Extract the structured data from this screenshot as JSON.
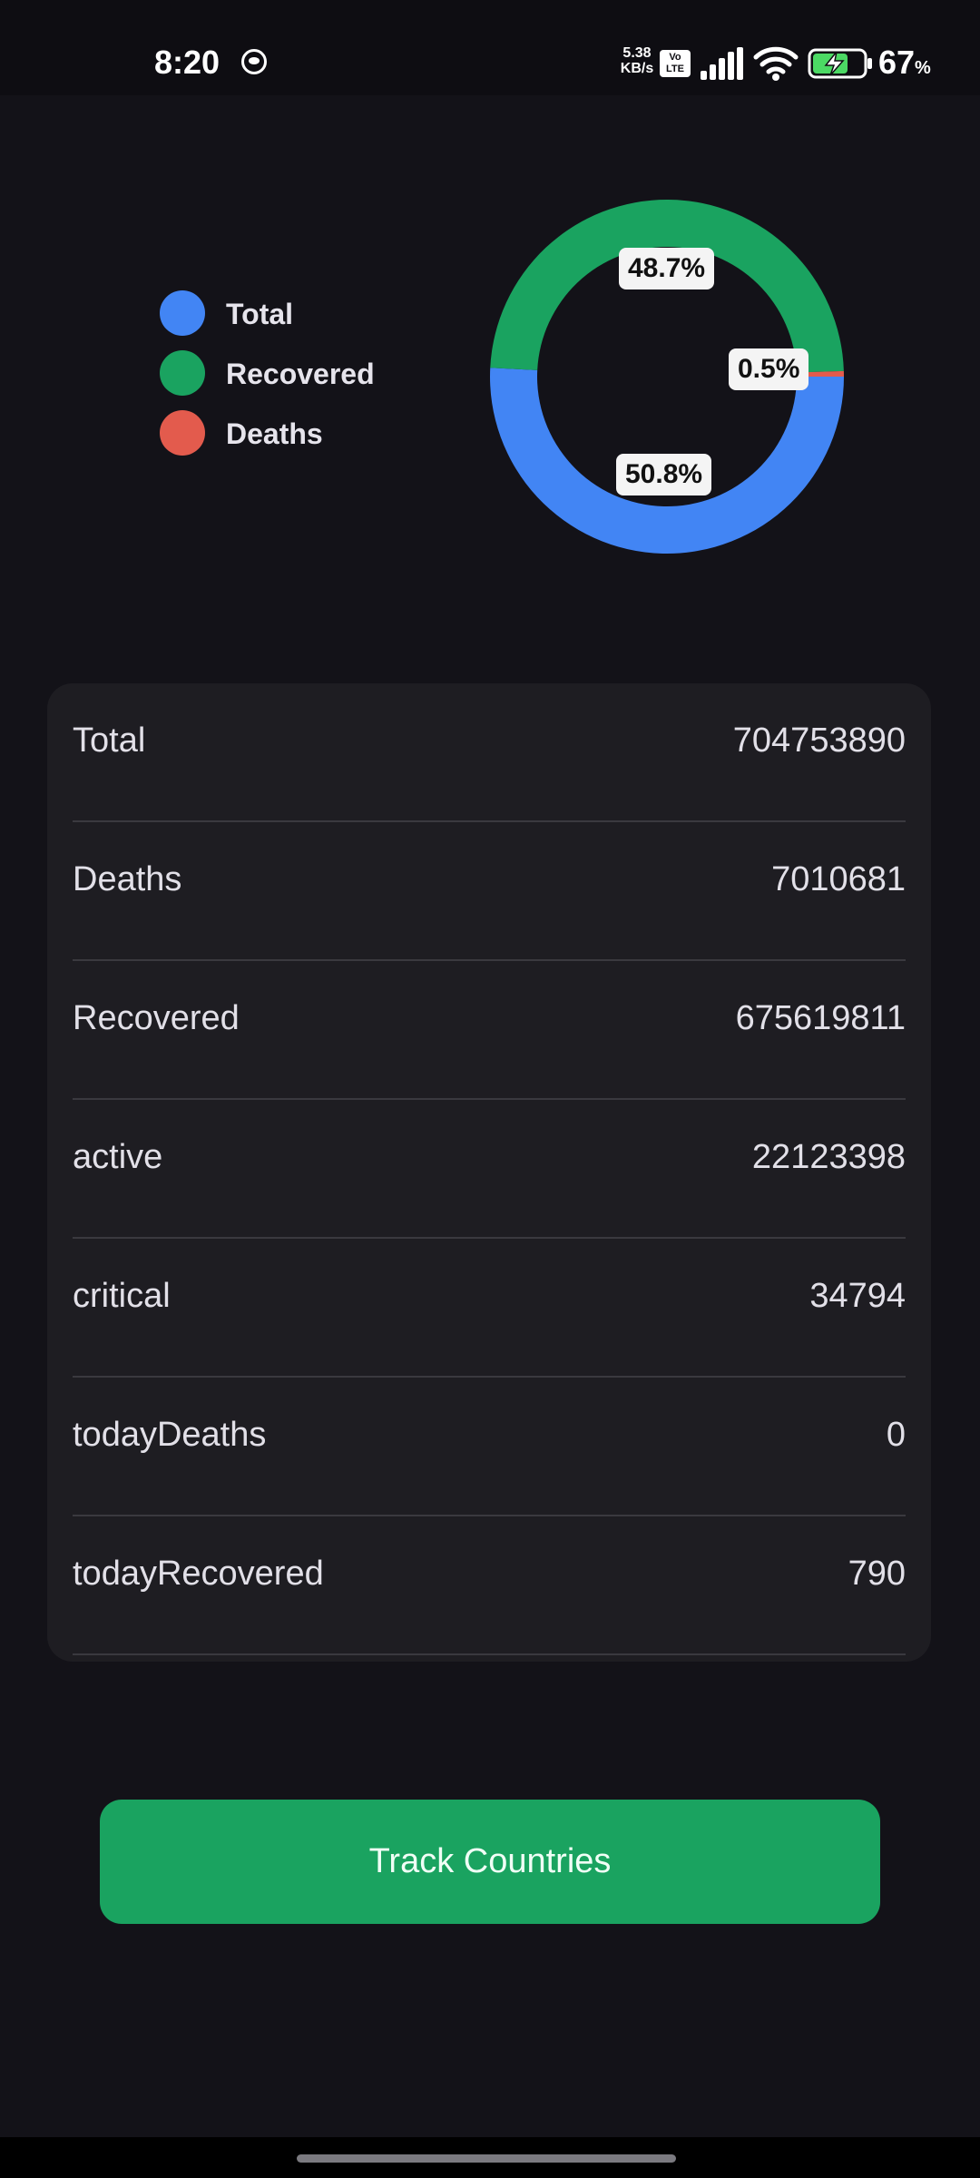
{
  "status_bar": {
    "time": "8:20",
    "net_speed_value": "5.38",
    "net_speed_unit": "KB/s",
    "volte_top": "Vo",
    "volte_bottom": "LTE",
    "battery_percent": "67",
    "battery_percent_sign": "%"
  },
  "legend": [
    {
      "label": "Total",
      "color": "#4285f4"
    },
    {
      "label": "Recovered",
      "color": "#1aa360"
    },
    {
      "label": "Deaths",
      "color": "#e35b4d"
    }
  ],
  "chart_data": {
    "type": "pie",
    "variant": "donut",
    "series": [
      {
        "name": "Total",
        "value": 50.8,
        "color": "#4285f4",
        "label": "50.8%"
      },
      {
        "name": "Recovered",
        "value": 48.7,
        "color": "#1aa360",
        "label": "48.7%"
      },
      {
        "name": "Deaths",
        "value": 0.5,
        "color": "#e35b4d",
        "label": "0.5%"
      }
    ]
  },
  "stats": [
    {
      "label": "Total",
      "value": "704753890"
    },
    {
      "label": "Deaths",
      "value": "7010681"
    },
    {
      "label": "Recovered",
      "value": "675619811"
    },
    {
      "label": "active",
      "value": "22123398"
    },
    {
      "label": "critical",
      "value": "34794"
    },
    {
      "label": "todayDeaths",
      "value": "0"
    },
    {
      "label": "todayRecovered",
      "value": "790"
    }
  ],
  "track_button": {
    "label": "Track Countries"
  }
}
